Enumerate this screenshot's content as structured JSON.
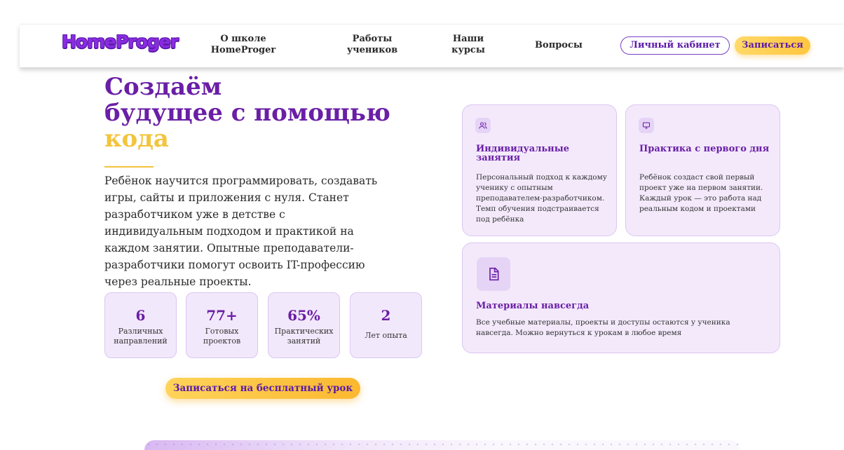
{
  "header": {
    "logo": "HomeProger",
    "nav": [
      {
        "line1": "О школе",
        "line2": "HomeProger"
      },
      {
        "line1": "Работы",
        "line2": "учеников"
      },
      {
        "line1": "Наши",
        "line2": "курсы"
      },
      {
        "line1": "Вопросы",
        "line2": ""
      }
    ],
    "cabinet_label": "Личный кабинет",
    "signup_label": "Записаться"
  },
  "hero": {
    "title_line1": "Создаём",
    "title_line2": "будущее с помощью",
    "title_accent": "кода",
    "lead": "Ребёнок научится программировать, создавать игры, сайты и приложения с нуля. Станет разработчиком уже в детстве с индивидуальным подходом и практикой на каждом занятии. Опытные преподаватели-разработчики помогут освоить IT-профессию через реальные проекты.",
    "stats": [
      {
        "value": "6",
        "label_line1": "Различных",
        "label_line2": "направлений"
      },
      {
        "value": "77+",
        "label_line1": "Готовых",
        "label_line2": "проектов"
      },
      {
        "value": "65%",
        "label_line1": "Практических",
        "label_line2": "занятий"
      },
      {
        "value": "2",
        "label_line1": "Лет опыта",
        "label_line2": ""
      }
    ],
    "cta_label": "Записаться на бесплатный урок"
  },
  "features": [
    {
      "icon": "users-icon",
      "title": "Индивидуальные занятия",
      "text": "Персональный подход к каждому ученику с опытным преподавателем-разработчиком. Темп обучения подстраивается под ребёнка"
    },
    {
      "icon": "monitor-icon",
      "title": "Практика с первого дня",
      "text": "Ребёнок создаст свой первый проект уже на первом занятии. Каждый урок — это работа над реальным кодом и проектами"
    },
    {
      "icon": "document-icon",
      "title": "Материалы навсегда",
      "text": "Все учебные материалы, проекты и доступы остаются у ученика навсегда. Можно вернуться к урокам в любое время"
    }
  ],
  "colors": {
    "brand_purple": "#6a1fa6",
    "accent_yellow": "#f3c43c",
    "card_bg": "#f3e9fb"
  }
}
